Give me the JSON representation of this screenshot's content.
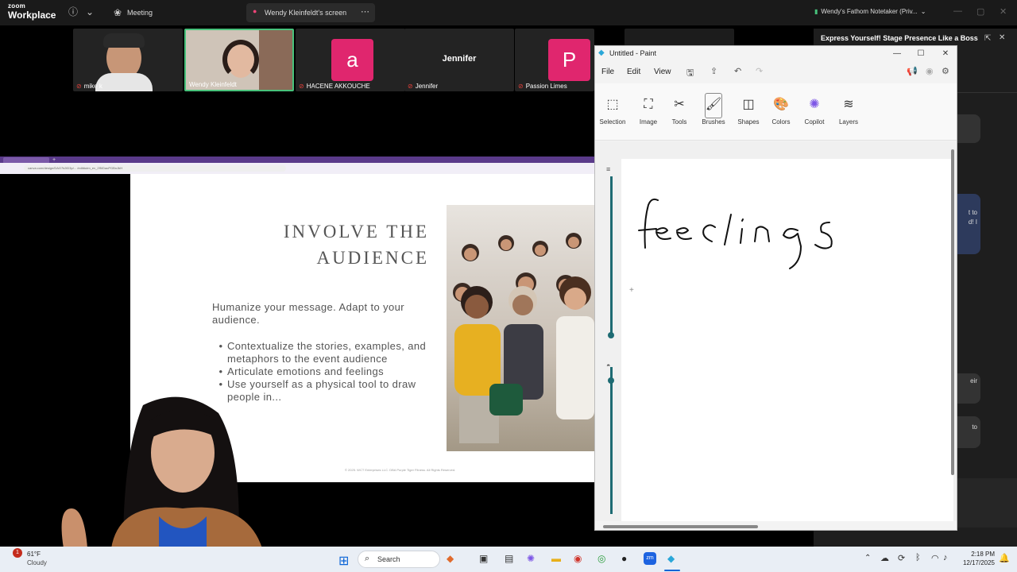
{
  "zoom": {
    "brand_small": "zoom",
    "brand_big": "Workplace",
    "meeting_label": "Meeting",
    "share_label": "Wendy Kleinfeldt's screen",
    "notetaker_label": "Wendy's Fathom Notetaker (Priv...",
    "panel_title": "Express Yourself! Stage Presence Like a Boss",
    "chat_fragments": [
      "t to",
      "d! I",
      "eir",
      "to"
    ]
  },
  "participants": [
    {
      "name": "mike k",
      "type": "video"
    },
    {
      "name": "Wendy Kleinfeldt",
      "type": "video"
    },
    {
      "name": "HACENE AKKOUCHE",
      "type": "avatar",
      "initial": "a",
      "color": "#e0266e"
    },
    {
      "name": "Jennifer",
      "type": "text",
      "center_label": "Jennifer"
    },
    {
      "name": "Passion Limes",
      "type": "avatar",
      "initial": "P",
      "color": "#e0266e"
    }
  ],
  "browser": {
    "url": "canva.com/design/DAG7k2iD3p/...  /edit#utm_ev_2f5/DaoPGBnJbH"
  },
  "slide": {
    "title_line1": "INVOLVE THE",
    "title_line2": "AUDIENCE",
    "intro": "Humanize your message. Adapt to your audience.",
    "bullets": [
      "Contextualize the stories, examples, and metaphors to the event audience",
      "Articulate emotions and feelings",
      "Use yourself as a physical tool to draw people in..."
    ],
    "footer": "© 2025. WCT Enterprises LLC. DBA Purple Tiger Fitness. All Rights Reserved."
  },
  "paint": {
    "title": "Untitled - Paint",
    "menus": [
      "File",
      "Edit",
      "View"
    ],
    "tools": [
      {
        "label": "Selection",
        "icon": "selection-icon"
      },
      {
        "label": "Image",
        "icon": "image-icon"
      },
      {
        "label": "Tools",
        "icon": "tools-icon"
      },
      {
        "label": "Brushes",
        "icon": "brush-icon"
      },
      {
        "label": "Shapes",
        "icon": "shapes-icon"
      },
      {
        "label": "Colors",
        "icon": "palette-icon"
      },
      {
        "label": "Copilot",
        "icon": "copilot-icon"
      },
      {
        "label": "Layers",
        "icon": "layers-icon"
      }
    ],
    "drawn_text": "feelings"
  },
  "taskbar": {
    "weather_temp": "61°F",
    "weather_desc": "Cloudy",
    "weather_badge": "1",
    "search_label": "Search",
    "time": "2:18 PM",
    "date": "12/17/2025"
  },
  "colors": {
    "accent_purple": "#5a3a8a",
    "avatar_pink": "#e0266e",
    "active_speaker_green": "#47c27b",
    "paint_slider_teal": "#1e6b73"
  }
}
